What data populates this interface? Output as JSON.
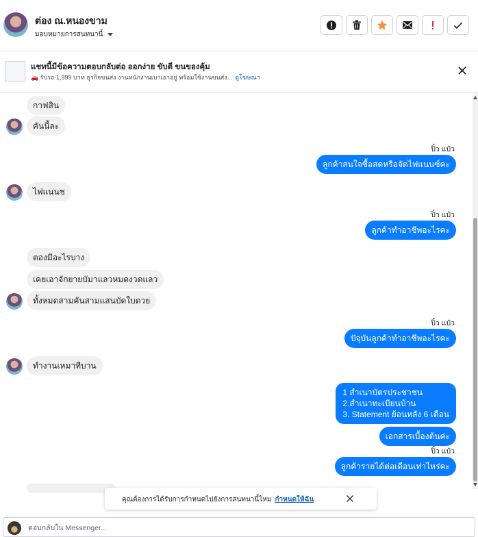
{
  "contact": {
    "name": "ต่อง ณ.หนองขาม",
    "assign_label": "มอบหมายการสนทนานี้"
  },
  "toolbar": {
    "buttons": [
      {
        "name": "spam-button",
        "icon": "alert-circle-icon"
      },
      {
        "name": "delete-button",
        "icon": "trash-icon"
      },
      {
        "name": "star-button",
        "icon": "star-icon",
        "color": "#f7923b"
      },
      {
        "name": "mark-unread-button",
        "icon": "envelope-icon"
      },
      {
        "name": "follow-up-button",
        "icon": "exclamation-icon",
        "color": "#e41e3f"
      },
      {
        "name": "done-button",
        "icon": "check-icon"
      }
    ]
  },
  "ad": {
    "title": "แชทนี้มีข้อความตอบกลับต่อ ออกง่าย ขับดี ขนของคุ้ม",
    "subtitle": "🚗 รับรถ 1,999 บาท ธุรกิจขนส่ง งานหนักงานเบาเอาอยู่ พร้อมใช้งานขนส่ง...",
    "link_text": "ดูโฆษณา"
  },
  "messages": [
    {
      "side": "in",
      "text": "กาฟสิน"
    },
    {
      "side": "in",
      "text": "คันนี้ละ"
    },
    {
      "side": "out",
      "sender": "ปิ๋ว แป๋ว",
      "text": "ลูกค้าสนใจซื้อสดหรือจัดไฟแนนซ์คะ"
    },
    {
      "side": "in",
      "text": "ไฟแนนช"
    },
    {
      "side": "out",
      "sender": "ปิ๋ว แป๋ว",
      "text": "ลูกค้าทำอาชีพอะไรคะ"
    },
    {
      "side": "in",
      "text": "ตองมีอะไรบาง"
    },
    {
      "side": "in",
      "text": "เคยเอาจักยายบัมาแลวหมดงวดแลว"
    },
    {
      "side": "in",
      "text": "ทั้งหมดสามคันสามแสนบัดใบดวย"
    },
    {
      "side": "out",
      "sender": "ปิ๋ว แป๋ว",
      "text": "ปัจุบันลูกค้าทำอาชีพอะไรคะ"
    },
    {
      "side": "in",
      "text": "ทำงานเหมาทีบาน"
    },
    {
      "side": "out",
      "lines": [
        "1 สำเนาบัตรประชาชน",
        "2.สำเนาทะเบียนบ้าน",
        "3. Statement ย้อนหลัง 6 เดือน"
      ]
    },
    {
      "side": "out",
      "text": "เอกสารเบื้องต้นค่ะ"
    },
    {
      "side": "out",
      "sender": "ปิ๋ว แป๋ว",
      "text": "ลูกค้ารายได้ต่อเดือนเท่าไหร่คะ"
    }
  ],
  "toast": {
    "text": "คุณต้องการได้รับการกำหนดไปยังการสนทนานี้ไหม",
    "link_text": "กำหนดให้ฉัน"
  },
  "composer": {
    "placeholder": "ตอบกลับใน Messenger..."
  }
}
